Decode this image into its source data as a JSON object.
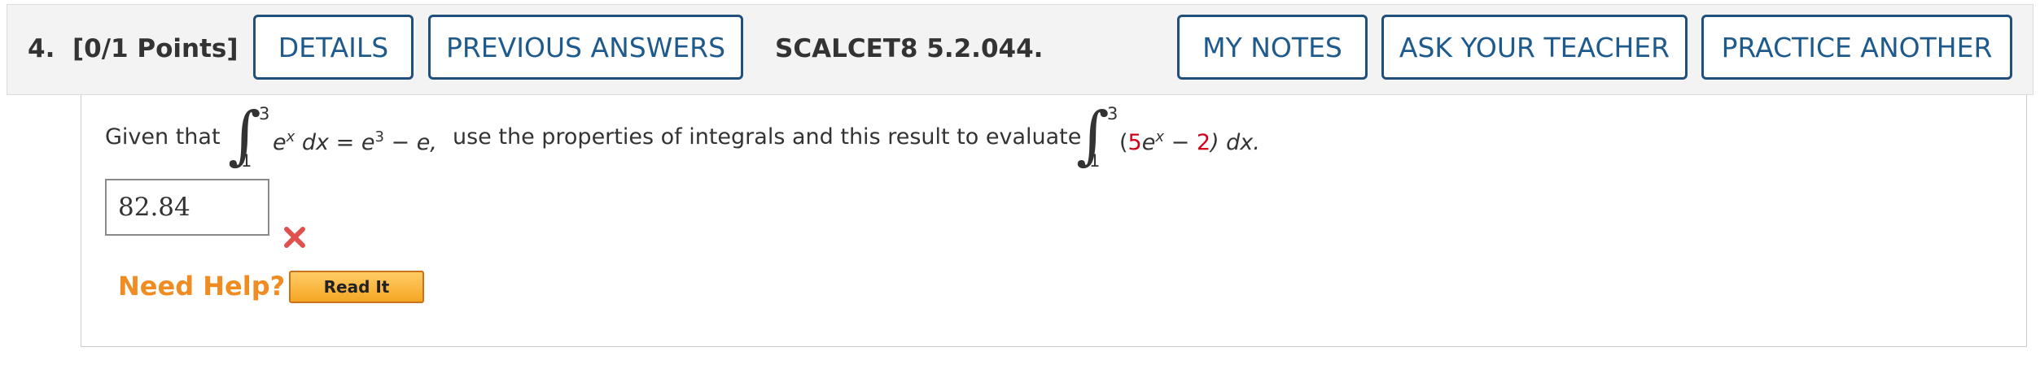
{
  "header": {
    "question_number": "4.",
    "points": "[0/1 Points]",
    "buttons": {
      "details": "DETAILS",
      "previous_answers": "PREVIOUS ANSWERS",
      "my_notes": "MY NOTES",
      "ask_teacher": "ASK YOUR TEACHER",
      "practice_another": "PRACTICE ANOTHER"
    },
    "problem_code": "SCALCET8 5.2.044."
  },
  "question": {
    "given_that": "Given that",
    "integral1": {
      "upper": "3",
      "lower": "1",
      "integrand": "e",
      "integrand_sup": "x",
      "dx": "dx"
    },
    "equals": "=",
    "rhs_base": "e",
    "rhs_sup": "3",
    "rhs_rest": "− e,",
    "instruction": "use the properties of integrals and this result to evaluate",
    "integral2": {
      "upper": "3",
      "lower": "1",
      "open_paren": "(",
      "coef": "5",
      "exp_base": "e",
      "exp_sup": "x",
      "minus": "−",
      "constant": "2",
      "close_paren_dx": ") dx."
    }
  },
  "answer": {
    "value": "82.84",
    "status_icon": "x-mark-icon",
    "status": "incorrect"
  },
  "help": {
    "label": "Need Help?",
    "read_it": "Read It"
  },
  "colors": {
    "button_border": "#1f4f7a",
    "accent_red": "#d0021b",
    "help_orange": "#f08c22"
  }
}
